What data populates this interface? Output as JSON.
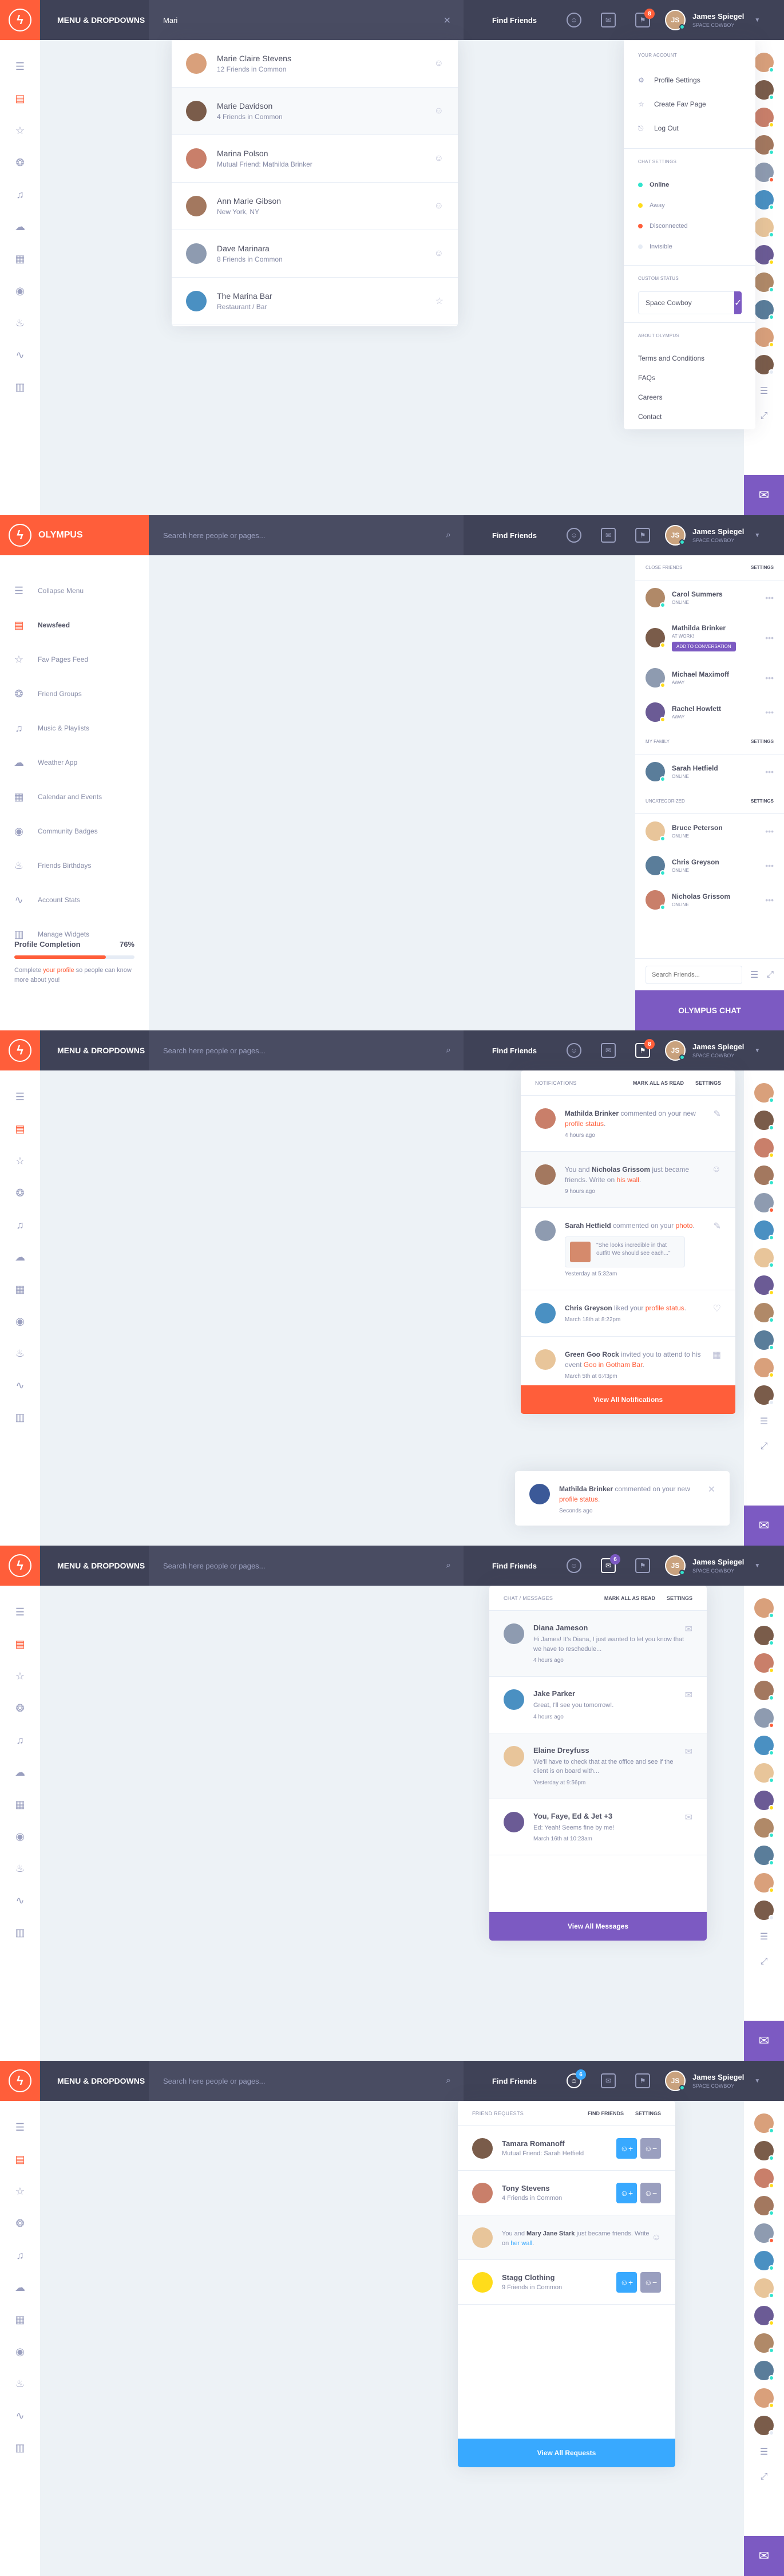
{
  "user": {
    "name": "James Spiegel",
    "status": "Space Cowboy",
    "initials": "JS"
  },
  "find_friends": "Find Friends",
  "page_title": "MENU & DROPDOWNS",
  "brand": "OLYMPUS",
  "search_placeholder": "Search here people or pages...",
  "colors": {
    "accent": "#ff5e3a",
    "purple": "#7c5ac2",
    "blue": "#38a9ff",
    "dark": "#3f4257",
    "green": "#32e4cd",
    "yellow": "#ffdc1b",
    "pink": "#ff5e3a"
  },
  "frame1": {
    "search_value": "Mari",
    "results": [
      {
        "name": "Marie Claire Stevens",
        "sub": "12 Friends in Common",
        "icon": "chat-icon"
      },
      {
        "name": "Marie Davidson",
        "sub": "4 Friends in Common",
        "icon": "chat-icon"
      },
      {
        "name": "Marina Polson",
        "sub": "Mutual Friend: Mathilda Brinker",
        "icon": "chat-icon"
      },
      {
        "name": "Ann Marie Gibson",
        "sub": "New York, NY",
        "icon": "chat-icon"
      },
      {
        "name": "Dave Marinara",
        "sub": "8 Friends in Common",
        "icon": "chat-icon"
      },
      {
        "name": "The Marina Bar",
        "sub": "Restaurant / Bar",
        "icon": "star-icon"
      }
    ],
    "menu": {
      "your_account": "Your Account",
      "items": [
        "Profile Settings",
        "Create Fav Page",
        "Log Out"
      ],
      "chat_settings": "Chat Settings",
      "statuses": [
        {
          "label": "Online",
          "color": "#32e4cd"
        },
        {
          "label": "Away",
          "color": "#ffdc1b"
        },
        {
          "label": "Disconnected",
          "color": "#ff5e3a"
        },
        {
          "label": "Invisible",
          "color": "#e6ecf5"
        }
      ],
      "custom_status": "Custom Status",
      "status_value": "Space Cowboy",
      "about_olympus": "About Olympus",
      "links": [
        "Terms and Conditions",
        "FAQs",
        "Careers",
        "Contact"
      ]
    }
  },
  "frame2": {
    "menu": [
      "Collapse Menu",
      "Newsfeed",
      "Fav Pages Feed",
      "Friend Groups",
      "Music & Playlists",
      "Weather App",
      "Calendar and Events",
      "Community Badges",
      "Friends Birthdays",
      "Account Stats",
      "Manage Widgets"
    ],
    "profile_completion": "Profile Completion",
    "profile_pct": "76%",
    "profile_pct_value": 76,
    "profile_text_pre": "Complete ",
    "profile_link": "your profile",
    "profile_text_post": " so people can know more about you!",
    "close_friends": "Close Friends",
    "settings": "Settings",
    "close_list": [
      {
        "name": "Carol Summers",
        "status": "Online",
        "dot": "#32e4cd"
      },
      {
        "name": "Mathilda Brinker",
        "status": "At work!",
        "dot": "#ffdc1b"
      },
      {
        "name": "Michael Maximoff",
        "status": "Away",
        "dot": "#ffdc1b"
      },
      {
        "name": "Rachel Howlett",
        "status": "Away",
        "dot": "#ffdc1b"
      }
    ],
    "add_conv": "Add to Conversation",
    "my_family": "My Family",
    "family_list": [
      {
        "name": "Sarah Hetfield",
        "status": "Online",
        "dot": "#32e4cd"
      }
    ],
    "uncategorized": "Uncategorized",
    "unc_list": [
      {
        "name": "Bruce Peterson",
        "status": "Online",
        "dot": "#32e4cd"
      },
      {
        "name": "Chris Greyson",
        "status": "Online",
        "dot": "#32e4cd"
      },
      {
        "name": "Nicholas Grissom",
        "status": "Online",
        "dot": "#32e4cd"
      }
    ],
    "search_friends": "Search Friends...",
    "chat_label": "OLYMPUS CHAT"
  },
  "frame3": {
    "badge": "8",
    "head": "Notifications",
    "mark": "Mark all as read",
    "settings": "Settings",
    "items": [
      {
        "pre": "",
        "name": "Mathilda Brinker",
        "mid": " commented on your new ",
        "link": "profile status",
        "post": ".",
        "time": "4 hours ago",
        "icon": "comment-icon"
      },
      {
        "pre": "You and ",
        "name": "Nicholas Grissom",
        "mid": " just became friends. Write on ",
        "link": "his wall",
        "post": ".",
        "time": "9 hours ago",
        "icon": "happy-face-icon"
      },
      {
        "pre": "",
        "name": "Sarah Hetfield",
        "mid": " commented on your ",
        "link": "photo",
        "post": ".",
        "time": "Yesterday at 5:32am",
        "icon": "comment-icon"
      },
      {
        "pre": "",
        "name": "Chris Greyson",
        "mid": " liked your ",
        "link": "profile status",
        "post": ".",
        "time": "March 18th at 8:22pm",
        "icon": "heart-icon"
      },
      {
        "pre": "",
        "name": "Green Goo Rock",
        "mid": " invited you to attend to his event ",
        "link": "Goo in Gotham Bar",
        "post": ".",
        "time": "March 5th at 6:43pm",
        "icon": "calendar-icon"
      }
    ],
    "quote": "\"She looks incredible in that outfit! We should see each...\"",
    "view_all": "View All Notifications",
    "toast": {
      "name": "Mathilda Brinker",
      "mid": " commented on your new ",
      "link": "profile status",
      "post": ".",
      "time": "Seconds ago"
    }
  },
  "frame4": {
    "badge": "6",
    "head": "Chat / Messages",
    "mark": "Mark all as read",
    "settings": "Settings",
    "items": [
      {
        "name": "Diana Jameson",
        "text": "Hi James! It's Diana, I just wanted to let you know that we have to reschedule...",
        "time": "4 hours ago"
      },
      {
        "name": "Jake Parker",
        "text": "Great, I'll see you tomorrow!.",
        "time": "4 hours ago"
      },
      {
        "name": "Elaine Dreyfuss",
        "text": "We'll have to check that at the office and see if the client is on board with...",
        "time": "Yesterday at 9:56pm"
      },
      {
        "name": "You, Faye, Ed & Jet +3",
        "text": "Ed: Yeah! Seems fine by me!",
        "time": "March 16th at 10:23am"
      }
    ],
    "view_all": "View All Messages"
  },
  "frame5": {
    "badge": "6",
    "head": "Friend Requests",
    "find": "Find Friends",
    "settings": "Settings",
    "items": [
      {
        "name": "Tamara Romanoff",
        "sub": "Mutual Friend: Sarah Hetfield",
        "type": "req"
      },
      {
        "name": "Tony Stevens",
        "sub": "4 Friends in Common",
        "type": "req"
      },
      {
        "pre": "You and ",
        "name": "Mary Jane Stark",
        "mid": " just became friends. Write on ",
        "link": "her wall",
        "post": ".",
        "type": "accepted"
      },
      {
        "name": "Stagg Clothing",
        "sub": "9 Friends in Common",
        "type": "req"
      }
    ],
    "view_all": "View All Requests"
  }
}
